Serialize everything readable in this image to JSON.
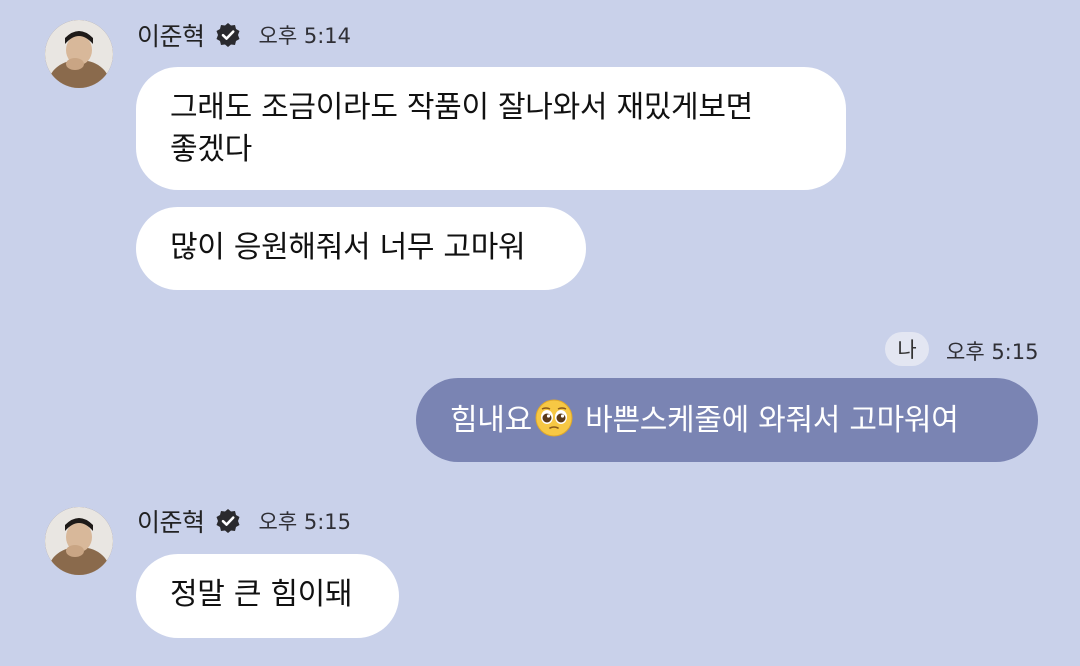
{
  "colors": {
    "background": "#c9d1ea",
    "incoming_bubble": "#ffffff",
    "outgoing_bubble": "#7a84b3",
    "verified_badge": "#2a2a2e"
  },
  "messages_group_1": {
    "sender": "이준혁",
    "time": "오후 5:14",
    "bubble_1_line_1": "그래도 조금이라도 작품이 잘나와서 재밌게보면",
    "bubble_1_line_2": "좋겠다",
    "bubble_2": "많이 응원해줘서 너무 고마워"
  },
  "my_message": {
    "badge": "나",
    "time": "오후 5:15",
    "text_before_emoji": "힘내요",
    "emoji": "pleading-face-emoji",
    "text_after_emoji": " 바쁜스케줄에 와줘서 고마워여"
  },
  "messages_group_2": {
    "sender": "이준혁",
    "time": "오후 5:15",
    "bubble_1": "정말 큰 힘이돼"
  }
}
